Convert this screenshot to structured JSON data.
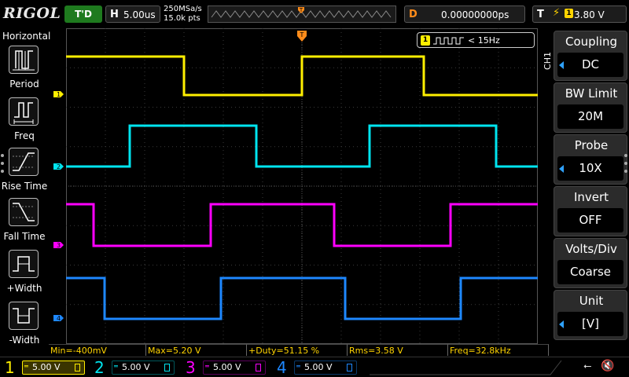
{
  "brand": "RIGOL",
  "run_status": "T'D",
  "timebase": {
    "key": "H",
    "value": "5.00us"
  },
  "acquisition": {
    "sample_rate": "250MSa/s",
    "memory_depth": "15.0k pts"
  },
  "delay": {
    "key": "D",
    "value": "0.00000000ps"
  },
  "trigger": {
    "key": "T",
    "source": "1",
    "level": "3.80 V",
    "edge": "rising"
  },
  "left_panel": {
    "title": "Horizontal",
    "items": [
      {
        "label": "Period"
      },
      {
        "label": "Freq"
      },
      {
        "label": "Rise Time"
      },
      {
        "label": "Fall Time"
      },
      {
        "label": "+Width"
      },
      {
        "label": "-Width"
      }
    ]
  },
  "freq_counter": {
    "channel": "1",
    "text": "< 15Hz"
  },
  "right_panel": {
    "channel_label": "CH1",
    "items": [
      {
        "title": "Coupling",
        "value": "DC"
      },
      {
        "title": "BW Limit",
        "value": "20M"
      },
      {
        "title": "Probe",
        "value": "10X"
      },
      {
        "title": "Invert",
        "value": "OFF"
      },
      {
        "title": "Volts/Div",
        "value": "Coarse"
      },
      {
        "title": "Unit",
        "value": "[V]"
      }
    ]
  },
  "measurements": [
    "Min=-400mV",
    "Max=5.20 V",
    "+Duty=51.15 %",
    "Rms=3.58 V",
    "Freq=32.8kHz"
  ],
  "channels": [
    {
      "num": "1",
      "scale": "5.00 V",
      "color": "#ffef00",
      "marker": "1"
    },
    {
      "num": "2",
      "scale": "5.00 V",
      "color": "#00e5ef",
      "marker": "2"
    },
    {
      "num": "3",
      "scale": "5.00 V",
      "color": "#ff00ff",
      "marker": "3"
    },
    {
      "num": "4",
      "scale": "5.00 V",
      "color": "#1e88ff",
      "marker": "4"
    }
  ],
  "colors": {
    "ch1": "#ffef00",
    "ch2": "#00e5ef",
    "ch3": "#ff00ff",
    "ch4": "#1e88ff",
    "trigger_marker": "#ff8c1a",
    "accent": "#2fa2ff"
  }
}
